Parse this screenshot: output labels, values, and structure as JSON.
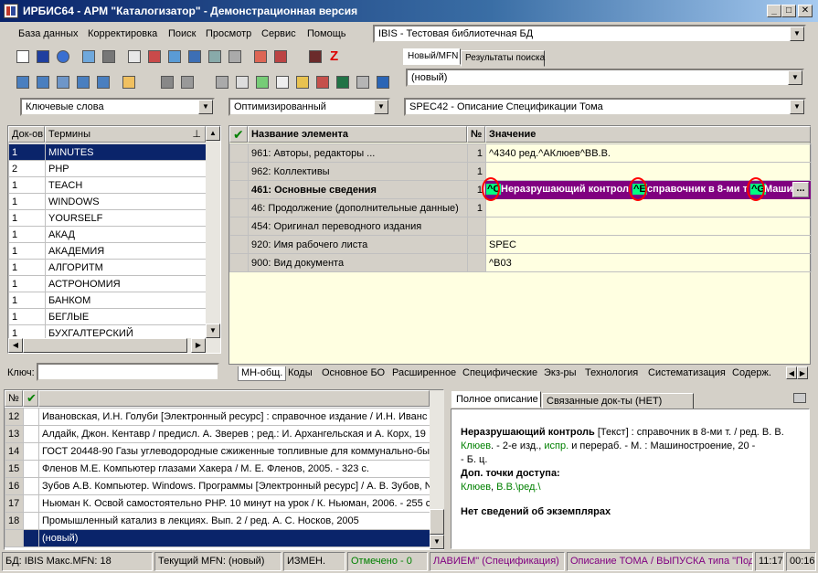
{
  "window": {
    "title": "ИРБИС64 - АРМ \"Каталогизатор\" - Демонстрационная версия",
    "minimize": "_",
    "maximize": "□",
    "close": "✕"
  },
  "menu": [
    "База данных",
    "Корректировка",
    "Поиск",
    "Просмотр",
    "Сервис",
    "Помощь"
  ],
  "database_select": "IBIS - Тестовая библиотечная БД",
  "search_tabs": [
    "Новый/MFN",
    "Результаты поиска"
  ],
  "record_select": "(новый)",
  "search_mode": "Ключевые слова",
  "optimization_select": "Оптимизированный",
  "worksheet_select": "SPEC42 - Описание Спецификации Тома",
  "dictionary": {
    "headers": [
      "Док-ов",
      "Термины"
    ],
    "rows": [
      {
        "count": "1",
        "term": "MINUTES"
      },
      {
        "count": "2",
        "term": "PHP"
      },
      {
        "count": "1",
        "term": "TEACH"
      },
      {
        "count": "1",
        "term": "WINDOWS"
      },
      {
        "count": "1",
        "term": "YOURSELF"
      },
      {
        "count": "1",
        "term": "АКАД"
      },
      {
        "count": "1",
        "term": "АКАДЕМИЯ"
      },
      {
        "count": "1",
        "term": "АЛГОРИТМ"
      },
      {
        "count": "1",
        "term": "АСТРОНОМИЯ"
      },
      {
        "count": "1",
        "term": "БАНКОМ"
      },
      {
        "count": "1",
        "term": "БЕГЛЫЕ"
      },
      {
        "count": "1",
        "term": "БУХГАЛТЕРСКИЙ"
      }
    ],
    "key_label": "Ключ:"
  },
  "fields": {
    "headers": [
      "Название элемента",
      "№",
      "Значение"
    ],
    "rows": [
      {
        "name": "961: Авторы, редакторы ...",
        "num": "1",
        "value": "^4340 ред.^AКлюев^BВ.В."
      },
      {
        "name": "962: Коллективы",
        "num": "1",
        "value": ""
      },
      {
        "name": "461: Основные сведения",
        "num": "1",
        "value": ""
      },
      {
        "name": "46: Продолжение (дополнительные данные)",
        "num": "1",
        "value": ""
      },
      {
        "name": "454: Оригинал переводного издания",
        "num": "",
        "value": ""
      },
      {
        "name": "920: Имя рабочего листа",
        "num": "",
        "value": "SPEC"
      },
      {
        "name": "900: Вид документа",
        "num": "",
        "value": "^B03"
      }
    ],
    "editing": {
      "seg1_code": "^C",
      "seg1_text": "Неразрушающий контрол",
      "seg2_code": "^E",
      "seg2_text": "справочник в 8-ми т",
      "seg3_code": "^G",
      "seg3_text": "Маши",
      "ellipsis": "..."
    },
    "tabs": [
      "МН-общ.",
      "Коды",
      "Основное БО",
      "Расширенное",
      "Специфические",
      "Экз-ры",
      "Технология",
      "Систематизация",
      "Содерж."
    ]
  },
  "records": {
    "header_num": "№",
    "rows": [
      {
        "num": "12",
        "text": "Ивановская, И.Н. Голуби [Электронный ресурс] : справочное издание / И.Н. Иванс"
      },
      {
        "num": "13",
        "text": "Алдайк, Джон. Кентавр / предисл. А. Зверев ; ред.: И. Архангельская и А. Корх, 19"
      },
      {
        "num": "14",
        "text": "ГОСТ 20448-90 Газы углеводородные сжиженные топливные для коммунально-бы"
      },
      {
        "num": "15",
        "text": "Фленов М.Е. Компьютер глазами Хакера / М. Е. Фленов, 2005. - 323 с."
      },
      {
        "num": "16",
        "text": "Зубов А.В. Компьютер. Windows. Программы [Электронный ресурс] / А. В. Зубов, N"
      },
      {
        "num": "17",
        "text": "Ньюман К. Освой самостоятельно PHP. 10 минут на урок / К. Ньюман, 2006. - 255 с"
      },
      {
        "num": "18",
        "text": "Промышленный катализ в лекциях. Вып. 2 / ред. А. С. Носков, 2005"
      },
      {
        "num": "",
        "text": "(новый)"
      }
    ]
  },
  "preview": {
    "tabs": [
      "Полное описание",
      "Связанные док-ты (НЕТ)"
    ],
    "title_bold": "Неразрушающий контроль",
    "line1_rest": " [Текст] : справочник в 8-ми т. / ред. В. В.",
    "line2_link1": "Клюев",
    "line2_mid": ". - 2-е изд.,",
    "line2_link2": "испр.",
    "line2_rest": " и перераб. - М. : Машиностроение, 20 -",
    "line3": "- Б. ц.",
    "access_label": "Доп. точки доступа:",
    "access_link1": "Клюев",
    "access_sep": ", ",
    "access_link2": "В.В.\\ред.\\",
    "no_copies": "Нет сведений об экземплярах"
  },
  "statusbar": {
    "db": "БД: IBIS Макс.MFN: 18",
    "current_mfn": "Текущий MFN: (новый)",
    "changed": "ИЗМЕН.",
    "marked": "Отмечено - 0",
    "worksheet": "ЛАВИЕМ\" (Спецификация)",
    "input_mode": "Описание ТОМА / ВЫПУСКА типа \"Под",
    "time": "11:17",
    "counter": "00:16"
  },
  "colors": {
    "title_start": "#0a246a",
    "selection": "#0a246a",
    "edit_row": "#800080",
    "code_highlight": "#00ff80",
    "link": "#008000",
    "pane_yellow": "#ffffe1",
    "marked_green": "#008000",
    "status_purple": "#800080",
    "annotation_red": "#ff0000"
  }
}
